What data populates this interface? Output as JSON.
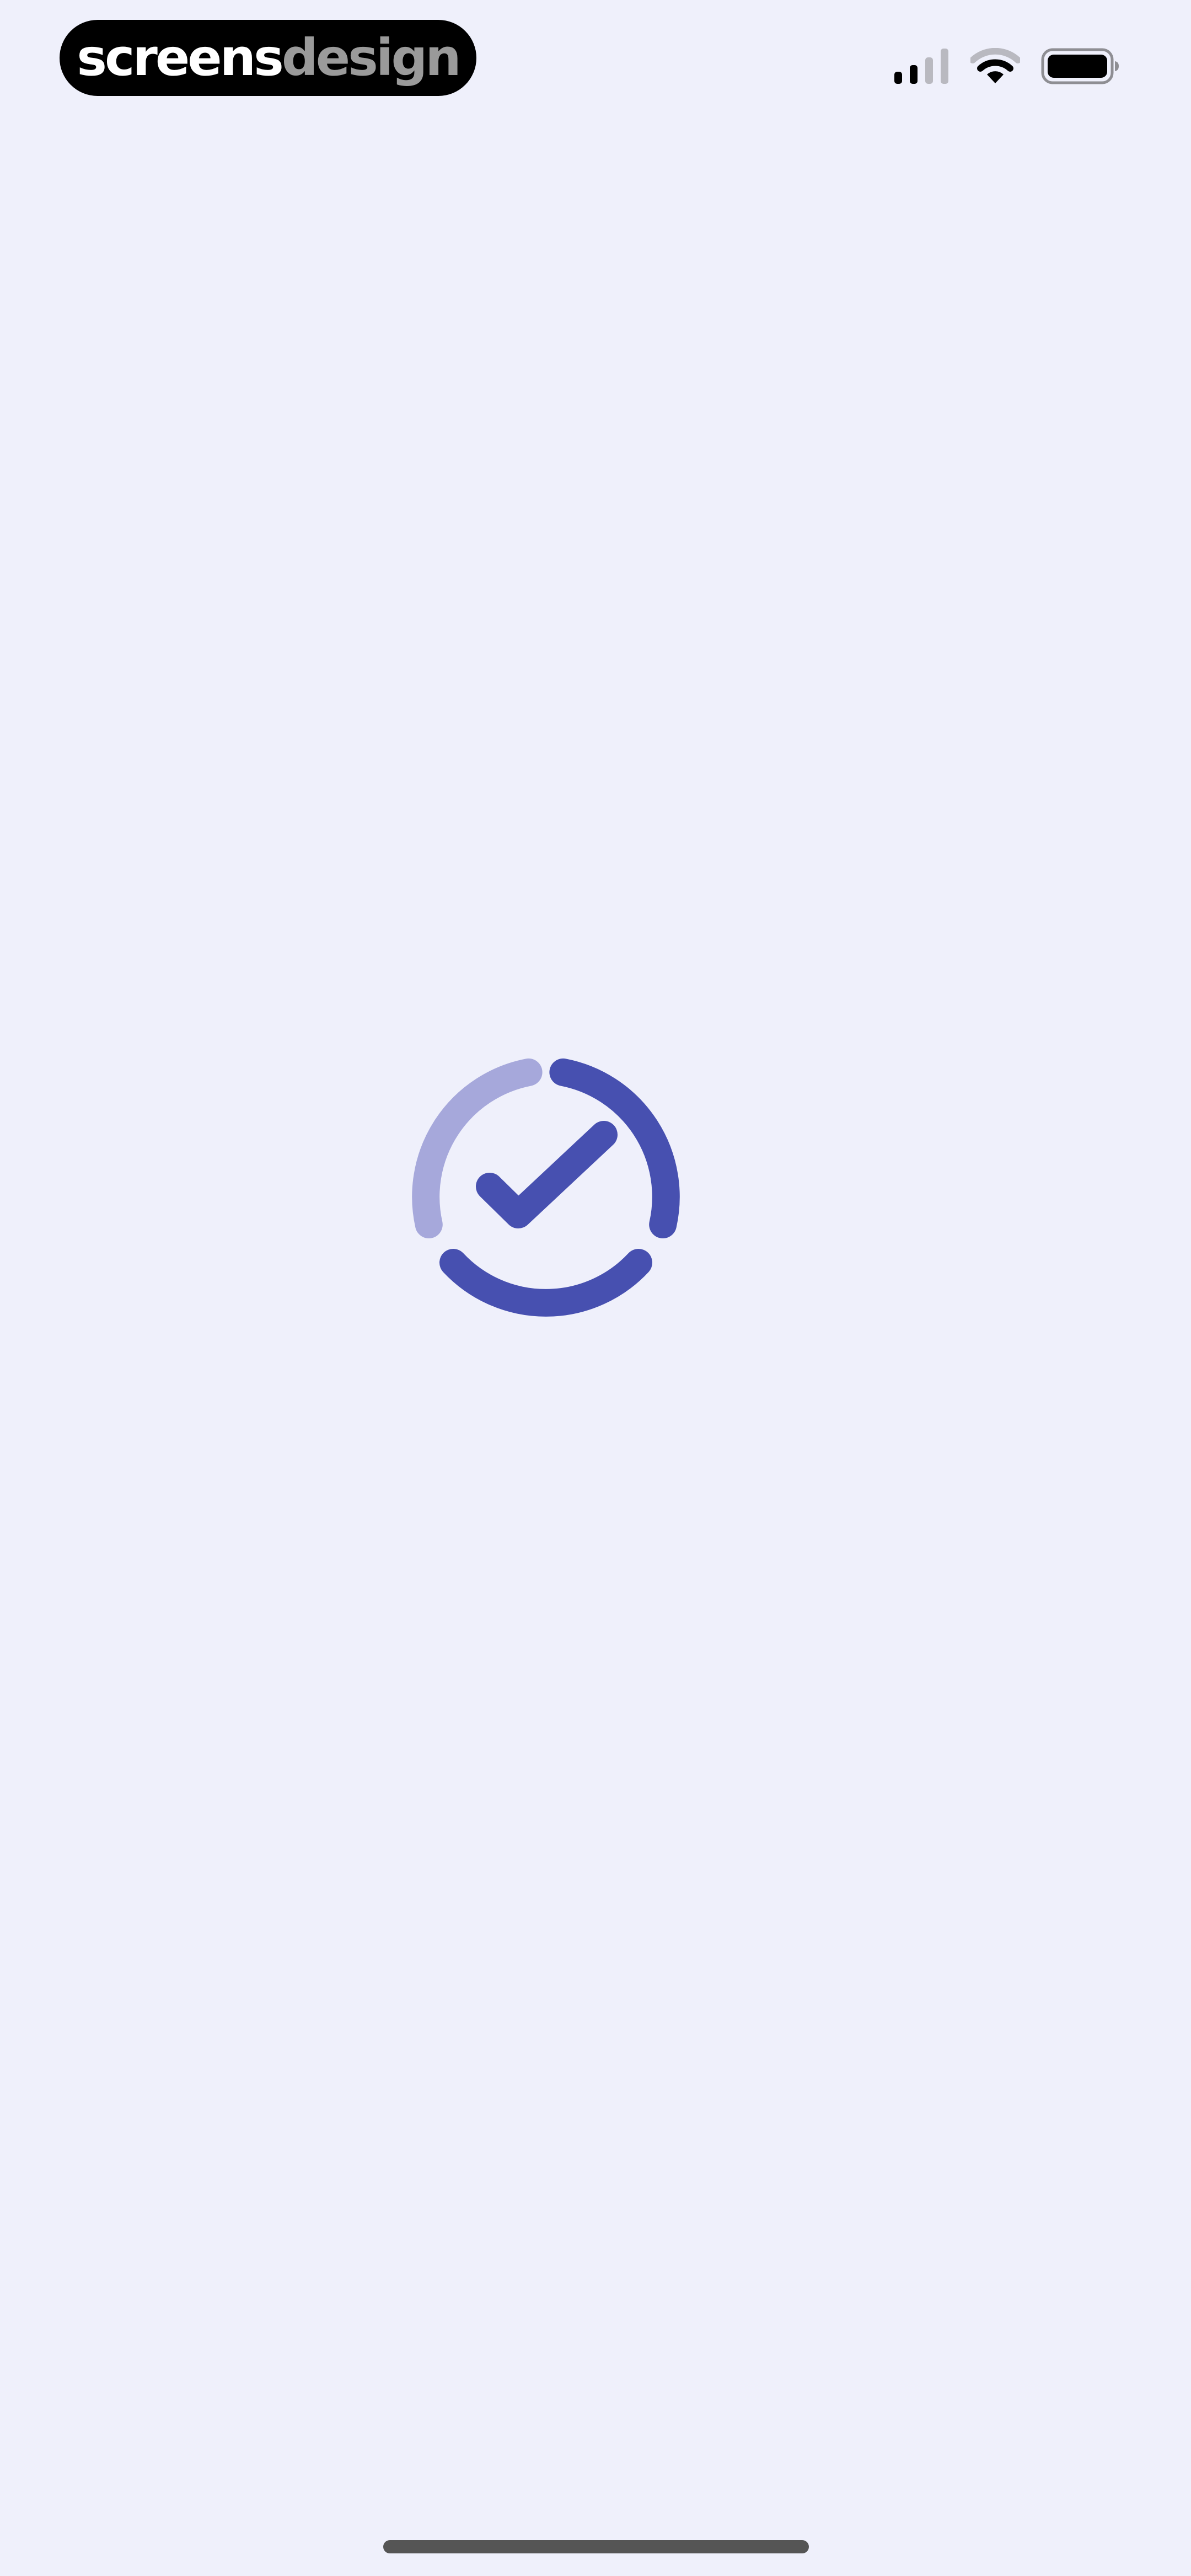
{
  "brand": {
    "part1": "screens",
    "part2": "design"
  },
  "status_bar": {
    "icons": [
      "cellular-signal-icon",
      "wifi-icon",
      "battery-icon"
    ]
  },
  "loader": {
    "icon": "check-circle-icon",
    "accent_color": "#4750b0",
    "faded_color": "#a6a8db"
  },
  "colors": {
    "background": "#eff0fb",
    "pill": "#000000"
  }
}
